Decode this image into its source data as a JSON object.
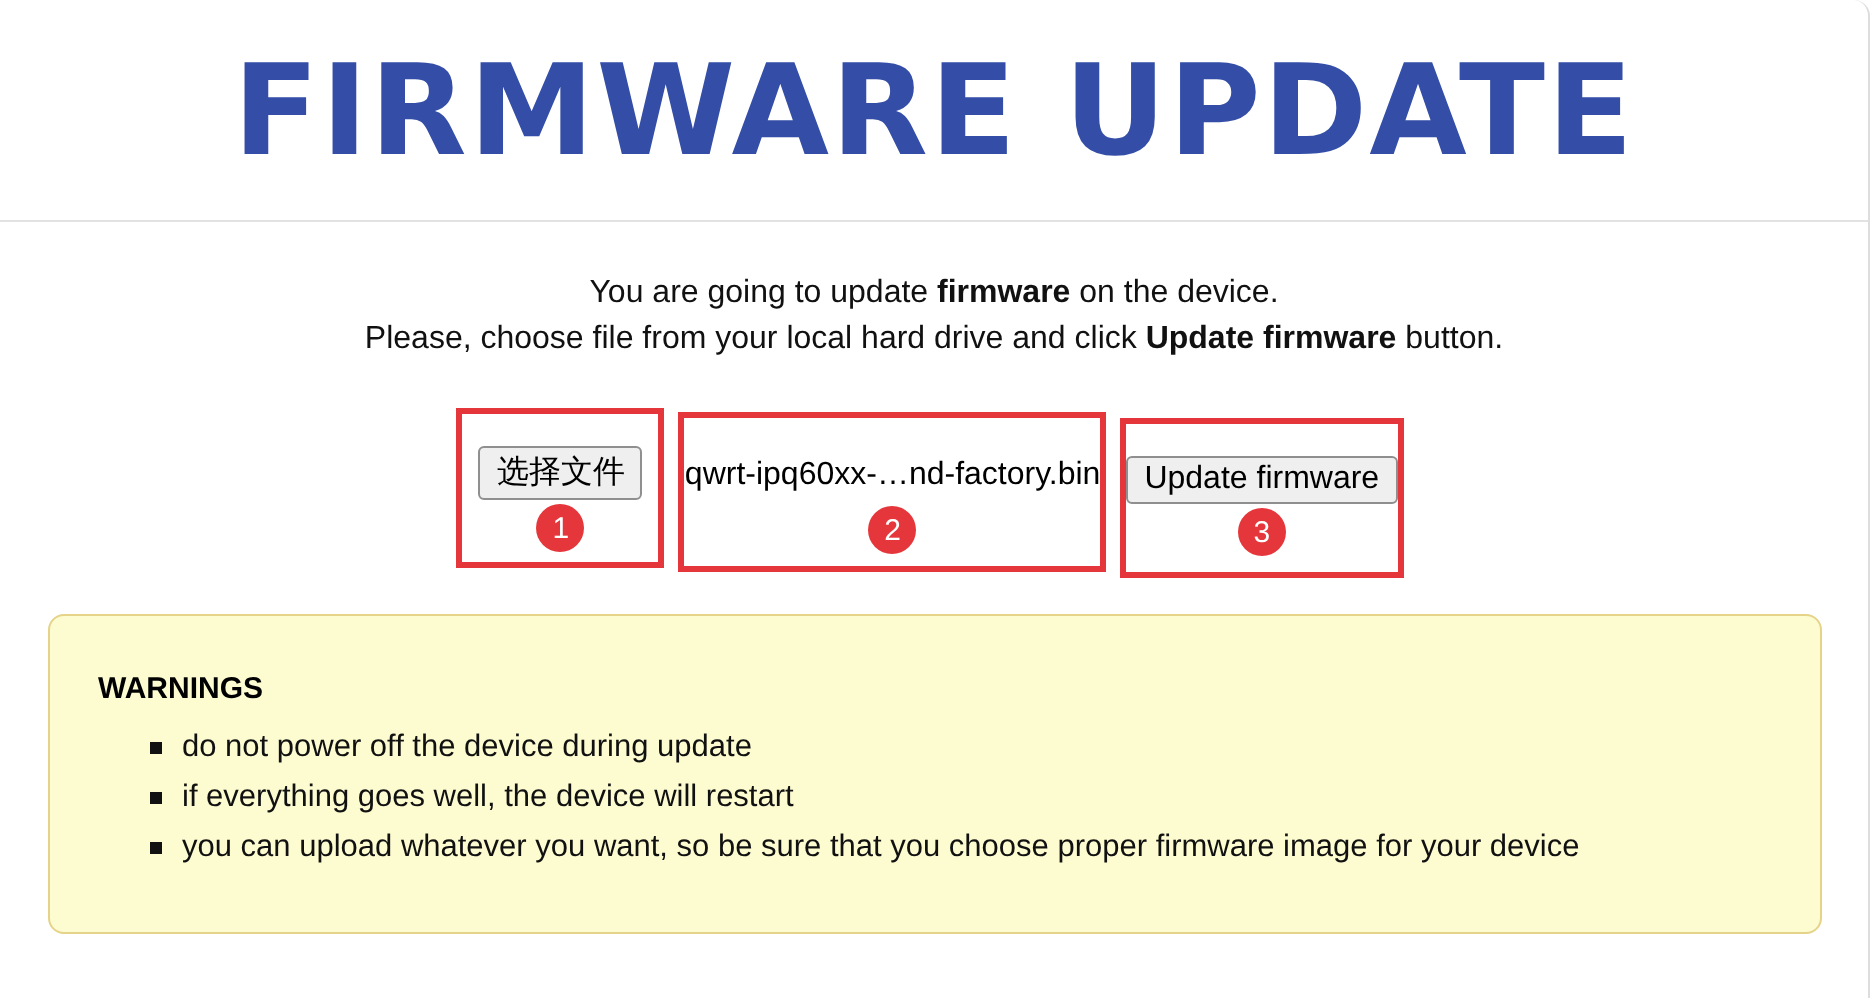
{
  "header": {
    "title": "FIRMWARE UPDATE"
  },
  "intro": [
    "You are going to update **firmware** on the device.",
    "Please, choose file from your local hard drive and click **Update firmware** button."
  ],
  "controls": [
    {
      "kind": "file_button",
      "label": "选择文件",
      "callout": "1"
    },
    {
      "kind": "file_name",
      "label": "qwrt-ipq60xx-…nd-factory.bin",
      "callout": "2"
    },
    {
      "kind": "submit",
      "label": "Update firmware",
      "callout": "3"
    }
  ],
  "warnings": {
    "title": "WARNINGS",
    "items": [
      "do not power off the device during update",
      "if everything goes well, the device will restart",
      "you can upload whatever you want, so be sure that you choose proper firmware image for your device"
    ]
  }
}
